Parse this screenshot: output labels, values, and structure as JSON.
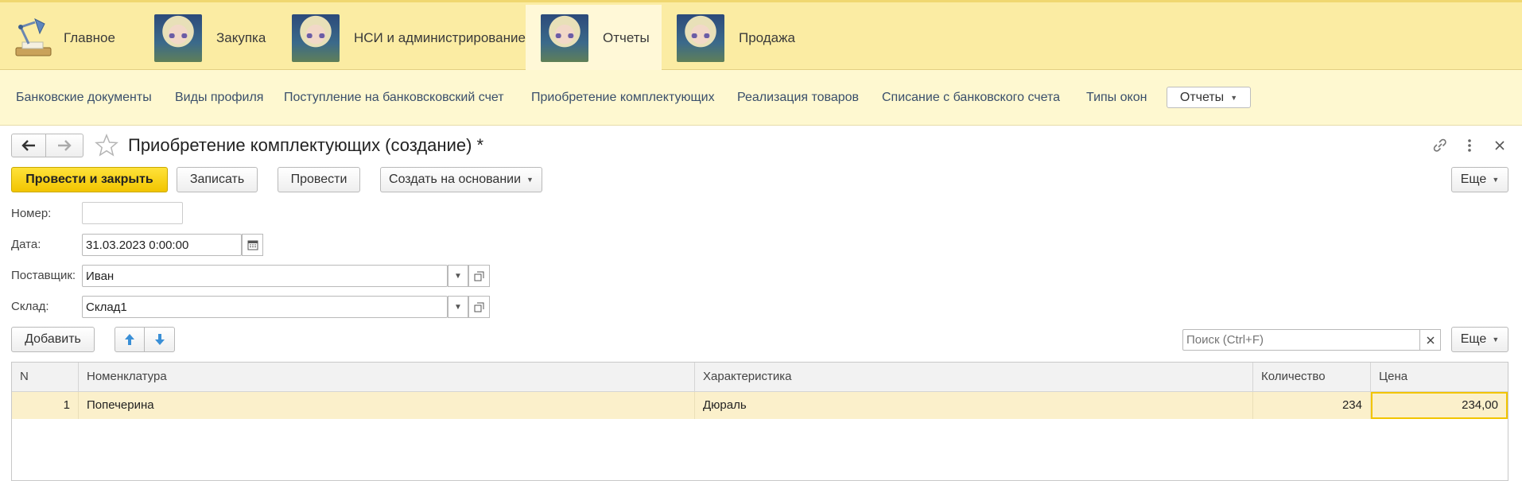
{
  "sections": [
    {
      "label": "Главное"
    },
    {
      "label": "Закупка"
    },
    {
      "label": "НСИ и администрирование"
    },
    {
      "label": "Отчеты"
    },
    {
      "label": "Продажа"
    }
  ],
  "nav": {
    "links": [
      "Банковские документы",
      "Виды профиля",
      "Поступление на банковсковский счет",
      "Приобретение комплектующих",
      "Реализация товаров",
      "Списание с банковского счета",
      "Типы окон"
    ],
    "reports_menu": "Отчеты"
  },
  "form": {
    "title": "Приобретение комплектующих (создание) *",
    "buttons": {
      "post_close": "Провести и закрыть",
      "save": "Записать",
      "post": "Провести",
      "create_based": "Создать на основании",
      "more": "Еще"
    },
    "fields": {
      "number_label": "Номер:",
      "number_value": "",
      "date_label": "Дата:",
      "date_value": "31.03.2023  0:00:00",
      "supplier_label": "Поставщик:",
      "supplier_value": "Иван",
      "warehouse_label": "Склад:",
      "warehouse_value": "Склад1"
    },
    "table_toolbar": {
      "add": "Добавить",
      "search_placeholder": "Поиск (Ctrl+F)",
      "more": "Еще"
    },
    "table": {
      "columns": [
        "N",
        "Номенклатура",
        "Характеристика",
        "Количество",
        "Цена"
      ],
      "rows": [
        {
          "n": "1",
          "nomenclature": "Попечерина",
          "characteristic": "Дюраль",
          "quantity": "234",
          "price": "234,00"
        }
      ]
    }
  },
  "colors": {
    "accent_yellow": "#f2c500",
    "topbar": "#fbeca3",
    "navbar": "#fef8d0",
    "selected_row": "#fbf0cb"
  }
}
